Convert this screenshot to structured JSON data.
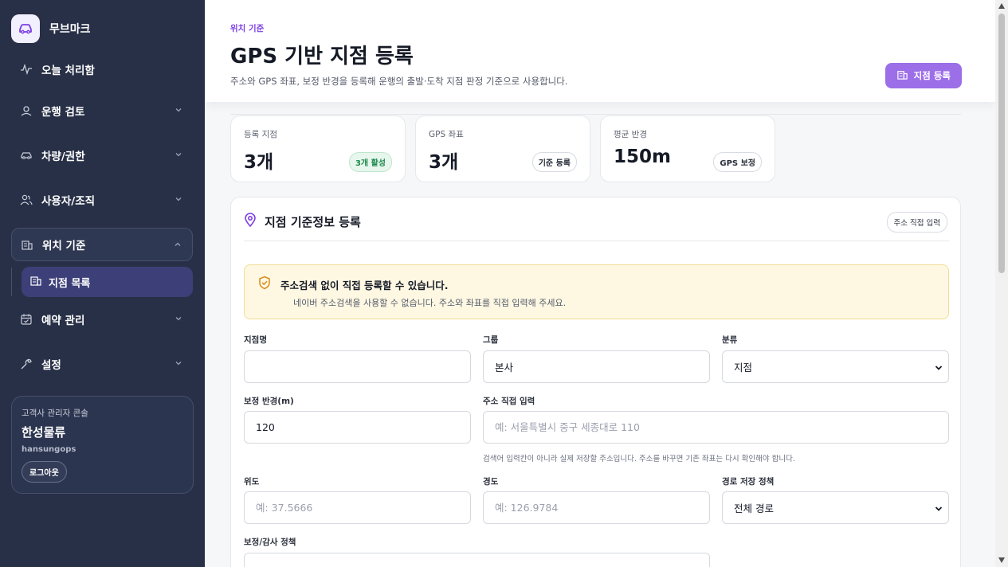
{
  "brand": {
    "name": "무브마크",
    "logo_icon": "car-icon",
    "logo_bg": "#f2efff",
    "accent": "#7b3fe4"
  },
  "sidebar": {
    "items": [
      {
        "label": "오늘 처리함",
        "icon": "activity-icon"
      },
      {
        "label": "운행 검토",
        "icon": "route-icon",
        "expandable": true
      },
      {
        "label": "차량/권한",
        "icon": "car-icon",
        "expandable": true
      },
      {
        "label": "사용자/조직",
        "icon": "users-icon",
        "expandable": true
      },
      {
        "label": "위치 기준",
        "icon": "building-icon",
        "expanded": true
      },
      {
        "label": "예약 관리",
        "icon": "calendar-check-icon",
        "expandable": true
      },
      {
        "label": "설정",
        "icon": "wrench-icon",
        "expandable": true
      }
    ],
    "sub_items": [
      {
        "label": "지점 목록",
        "icon": "building-icon",
        "active": true
      }
    ],
    "account": {
      "role": "고객사 관리자 콘솔",
      "company": "한성물류",
      "user_id": "hansungops",
      "logout": "로그아웃"
    }
  },
  "header": {
    "eyebrow": "위치 기준",
    "title": "GPS 기반 지점 등록",
    "description": "주소와 GPS 좌표, 보정 반경을 등록해 운행의 출발·도착 지점 판정 기준으로 사용합니다.",
    "primary_button": "지점 등록"
  },
  "stats": [
    {
      "label": "등록 지점",
      "value": "3개",
      "badge": "3개 활성",
      "badge_color": "#1d8a4b"
    },
    {
      "label": "GPS 좌표",
      "value": "3개",
      "badge": "기준 등록"
    },
    {
      "label": "평균 반경",
      "value": "150m",
      "badge": "GPS 보정"
    }
  ],
  "form": {
    "title": "지점 기준정보 등록",
    "mode_badge": "주소 직접 입력",
    "notice": {
      "title": "주소검색 없이 직접 등록할 수 있습니다.",
      "text": "네이버 주소검색을 사용할 수 없습니다. 주소와 좌표를 직접 입력해 주세요."
    },
    "fields": {
      "name": {
        "label": "지점명",
        "value": "",
        "placeholder": ""
      },
      "group": {
        "label": "그룹",
        "value": "본사"
      },
      "category": {
        "label": "분류",
        "value": "지점"
      },
      "radius": {
        "label": "보정 반경(m)",
        "value": "120"
      },
      "address": {
        "label": "주소 직접 입력",
        "value": "",
        "placeholder": "예: 서울특별시 중구 세종대로 110",
        "hint": "검색어 입력칸이 아니라 실제 저장할 주소입니다. 주소를 바꾸면 기존 좌표는 다시 확인해야 합니다."
      },
      "latitude": {
        "label": "위도",
        "value": "",
        "placeholder": "예: 37.5666"
      },
      "longitude": {
        "label": "경도",
        "value": "",
        "placeholder": "예: 126.9784"
      },
      "route_policy": {
        "label": "경로 저장 정책",
        "value": "전체 경로"
      },
      "audit_policy": {
        "label": "보정/감사 정책"
      }
    }
  }
}
